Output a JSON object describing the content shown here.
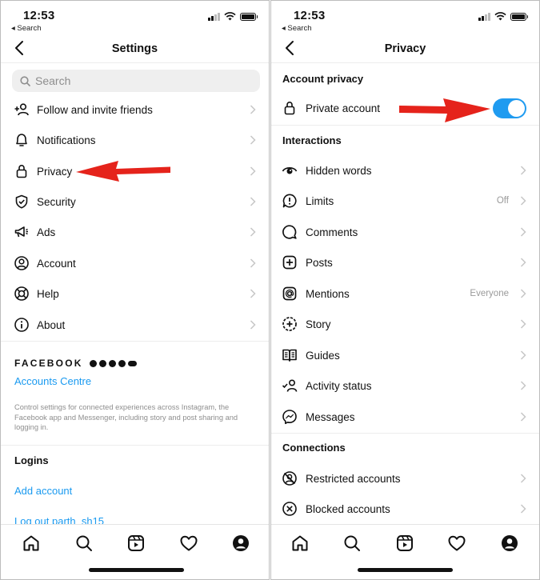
{
  "status": {
    "time": "12:53",
    "back_label": "◂ Search"
  },
  "settings": {
    "title": "Settings",
    "search_placeholder": "Search",
    "items": [
      {
        "label": "Follow and invite friends",
        "icon": "add-person-icon"
      },
      {
        "label": "Notifications",
        "icon": "bell-icon"
      },
      {
        "label": "Privacy",
        "icon": "lock-icon"
      },
      {
        "label": "Security",
        "icon": "shield-icon"
      },
      {
        "label": "Ads",
        "icon": "megaphone-icon"
      },
      {
        "label": "Account",
        "icon": "account-circle-icon"
      },
      {
        "label": "Help",
        "icon": "lifebuoy-icon"
      },
      {
        "label": "About",
        "icon": "info-icon"
      }
    ],
    "facebook_label": "FACEBOOK",
    "accounts_centre": "Accounts Centre",
    "description": "Control settings for connected experiences across Instagram, the Facebook app and Messenger, including story and post sharing and logging in.",
    "logins_header": "Logins",
    "add_account": "Add account",
    "log_out": "Log out parth_sh15"
  },
  "privacy": {
    "title": "Privacy",
    "account_privacy_header": "Account privacy",
    "private_account_label": "Private account",
    "private_account_enabled": true,
    "interactions_header": "Interactions",
    "items": [
      {
        "label": "Hidden words",
        "value": "",
        "icon": "hidden-eye-icon"
      },
      {
        "label": "Limits",
        "value": "Off",
        "icon": "limits-icon"
      },
      {
        "label": "Comments",
        "value": "",
        "icon": "comment-icon"
      },
      {
        "label": "Posts",
        "value": "",
        "icon": "plus-square-icon"
      },
      {
        "label": "Mentions",
        "value": "Everyone",
        "icon": "at-icon"
      },
      {
        "label": "Story",
        "value": "",
        "icon": "story-icon"
      },
      {
        "label": "Guides",
        "value": "",
        "icon": "guides-icon"
      },
      {
        "label": "Activity status",
        "value": "",
        "icon": "activity-status-icon"
      },
      {
        "label": "Messages",
        "value": "",
        "icon": "messenger-icon"
      }
    ],
    "connections_header": "Connections",
    "connections": [
      {
        "label": "Restricted accounts",
        "icon": "restricted-icon"
      },
      {
        "label": "Blocked accounts",
        "icon": "blocked-icon"
      }
    ]
  },
  "colors": {
    "accent": "#1f9bf0",
    "link": "#1a9af0",
    "arrow": "#e5231b"
  }
}
